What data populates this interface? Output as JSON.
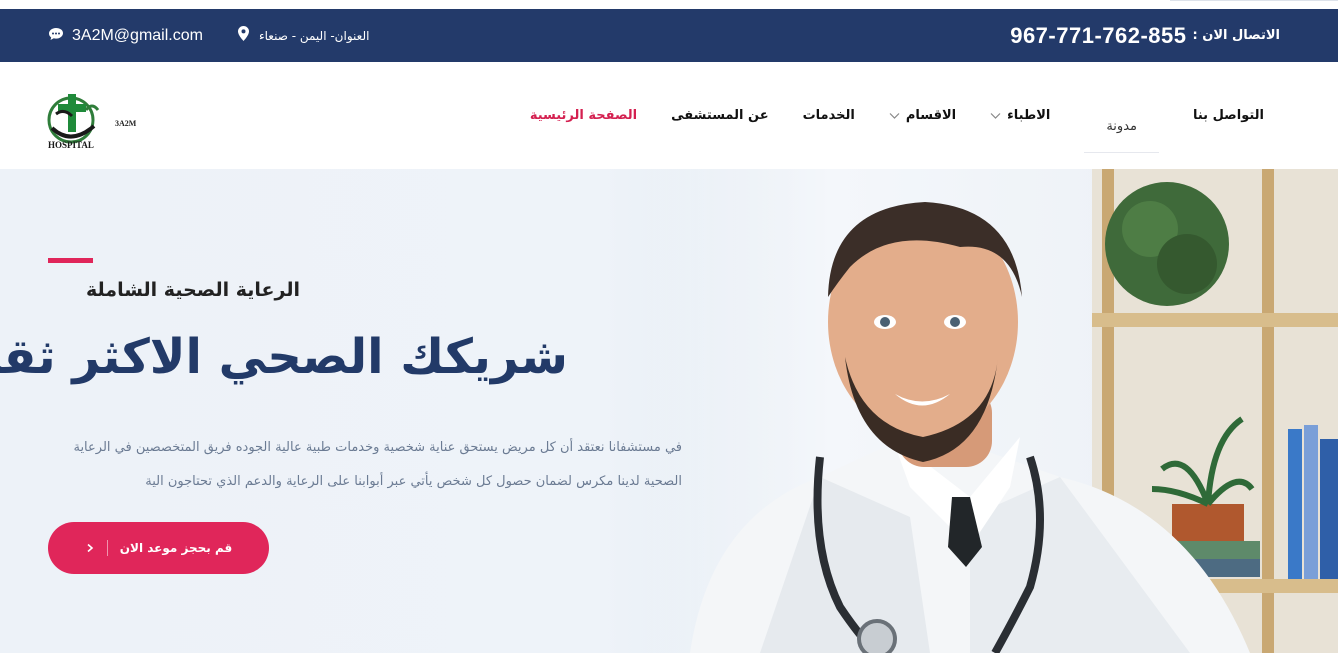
{
  "topbar": {
    "contact_label": "الاتصال الان :",
    "phone": "967-771-762-855",
    "email": "3A2M@gmail.com",
    "address": "العنوان- اليمن - صنعاء",
    "icons": [
      "map-pin-icon",
      "chat-bubble-icon"
    ]
  },
  "nav": {
    "logo_text": "3A2M",
    "items": [
      {
        "label": "التواصل بنا",
        "dropdown": false
      },
      {
        "label": "مدونة",
        "dropdown": false
      },
      {
        "label": "الاطباء",
        "dropdown": true
      },
      {
        "label": "الاقسام",
        "dropdown": true
      },
      {
        "label": "الخدمات",
        "dropdown": false
      },
      {
        "label": "عن المستشفى",
        "dropdown": false
      },
      {
        "label": "الصفحة الرئيسية",
        "dropdown": false,
        "active": true
      }
    ]
  },
  "hero": {
    "subtitle": "الرعاية الصحية الشاملة",
    "headline": "شريكك الصحي الاكثر ثقة",
    "paragraph": "في مستشفانا نعتقد أن كل مريض يستحق عناية شخصية وخدمات طبية عالية الجوده فريق المتخصصين في الرعاية الصحية لدينا مكرس لضمان حصول كل شخص يأتي عبر أبوابنا على الرعاية والدعم الذي تحتاجون الية",
    "cta_label": "قم بحجز موعد الان"
  },
  "colors": {
    "topbar_bg": "#233a6a",
    "accent": "#e0265a",
    "headline": "#223a68"
  }
}
